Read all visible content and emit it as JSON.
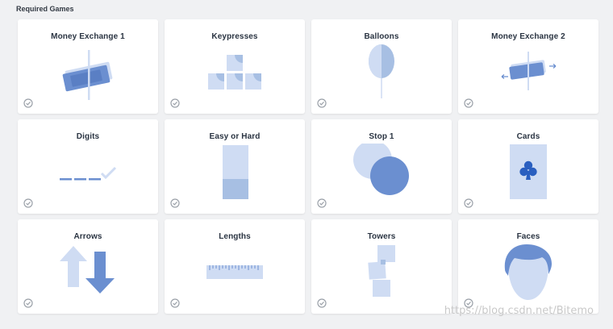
{
  "section": {
    "title": "Required Games"
  },
  "games": [
    {
      "title": "Money Exchange 1",
      "icon": "money-exchange-icon"
    },
    {
      "title": "Keypresses",
      "icon": "keypresses-icon"
    },
    {
      "title": "Balloons",
      "icon": "balloon-icon"
    },
    {
      "title": "Money Exchange 2",
      "icon": "money-exchange-arrows-icon"
    },
    {
      "title": "Digits",
      "icon": "digits-icon"
    },
    {
      "title": "Easy or Hard",
      "icon": "easy-hard-icon"
    },
    {
      "title": "Stop 1",
      "icon": "stop-circles-icon"
    },
    {
      "title": "Cards",
      "icon": "club-card-icon"
    },
    {
      "title": "Arrows",
      "icon": "up-down-arrows-icon"
    },
    {
      "title": "Lengths",
      "icon": "ruler-icon"
    },
    {
      "title": "Towers",
      "icon": "towers-icon"
    },
    {
      "title": "Faces",
      "icon": "face-icon"
    }
  ],
  "watermark": "https://blog.csdn.net/Bitemo",
  "colors": {
    "dark_blue": "#6b8fd0",
    "mid_blue": "#a7bfe3",
    "light_blue": "#cfdcf3",
    "check_gray": "#9aa0a8"
  }
}
